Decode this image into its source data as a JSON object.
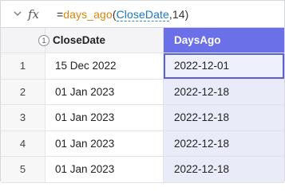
{
  "formula_bar": {
    "dropdown_icon": "chevron-down-icon",
    "fx_label": "fx",
    "equals": "=",
    "function_name": "days_ago",
    "open_paren": "(",
    "argument_ref": "CloseDate",
    "comma": ",",
    "argument_number": "14",
    "close_paren": ")"
  },
  "grid": {
    "column_badge": "1",
    "columns": [
      "CloseDate",
      "DaysAgo"
    ],
    "rows": [
      {
        "num": "1",
        "close_date": "15 Dec 2022",
        "days_ago": "2022-12-01"
      },
      {
        "num": "2",
        "close_date": "01 Jan 2023",
        "days_ago": "2022-12-18"
      },
      {
        "num": "3",
        "close_date": "01 Jan 2023",
        "days_ago": "2022-12-18"
      },
      {
        "num": "4",
        "close_date": "01 Jan 2023",
        "days_ago": "2022-12-18"
      },
      {
        "num": "5",
        "close_date": "01 Jan 2023",
        "days_ago": "2022-12-18"
      }
    ]
  },
  "colors": {
    "header_selected": "#6b6fe8",
    "column_tint": "#e9ebf8",
    "function_color": "#d9860b",
    "reference_color": "#1a78c2"
  }
}
